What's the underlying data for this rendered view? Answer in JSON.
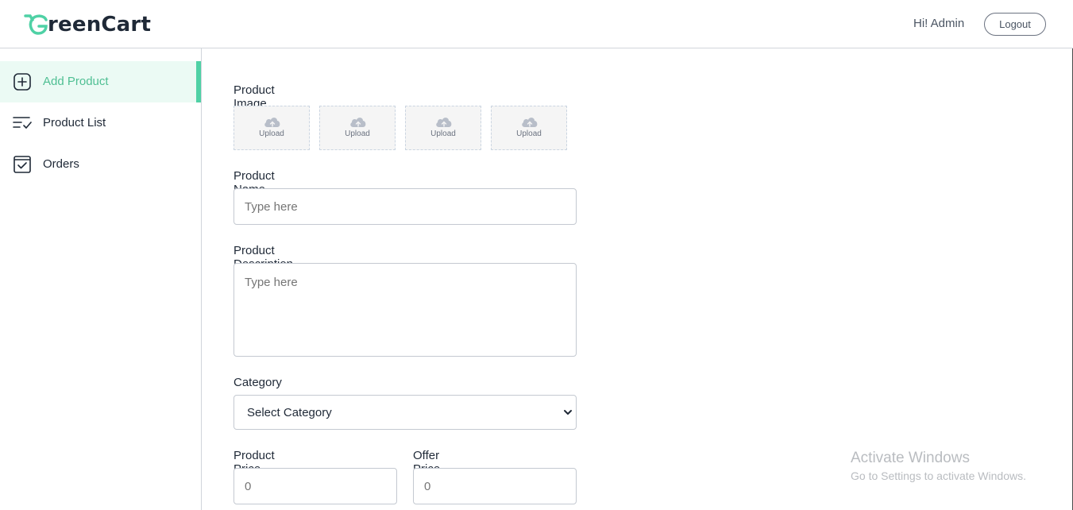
{
  "header": {
    "logo_text": "reenCart",
    "logo_letter": "G",
    "greeting": "Hi! Admin",
    "logout_label": "Logout"
  },
  "sidebar": {
    "items": [
      {
        "label": "Add Product",
        "icon": "add-square-icon",
        "active": true
      },
      {
        "label": "Product List",
        "icon": "list-check-icon",
        "active": false
      },
      {
        "label": "Orders",
        "icon": "order-check-icon",
        "active": false
      }
    ]
  },
  "form": {
    "image_label": "Product Image",
    "upload_label": "Upload",
    "uploads": [
      "Upload",
      "Upload",
      "Upload",
      "Upload"
    ],
    "name_label": "Product Name",
    "name_placeholder": "Type here",
    "description_label": "Product Description",
    "description_placeholder": "Type here",
    "category_label": "Category",
    "category_selected": "Select Category",
    "price_label": "Product Price",
    "price_placeholder": "0",
    "offer_label": "Offer Price",
    "offer_placeholder": "0"
  },
  "watermark": {
    "line1": "Activate Windows",
    "line2": "Go to Settings to activate Windows."
  },
  "colors": {
    "accent": "#4fd1a5",
    "accent_text": "#4fbf93",
    "active_bg": "#ebfaf4"
  }
}
